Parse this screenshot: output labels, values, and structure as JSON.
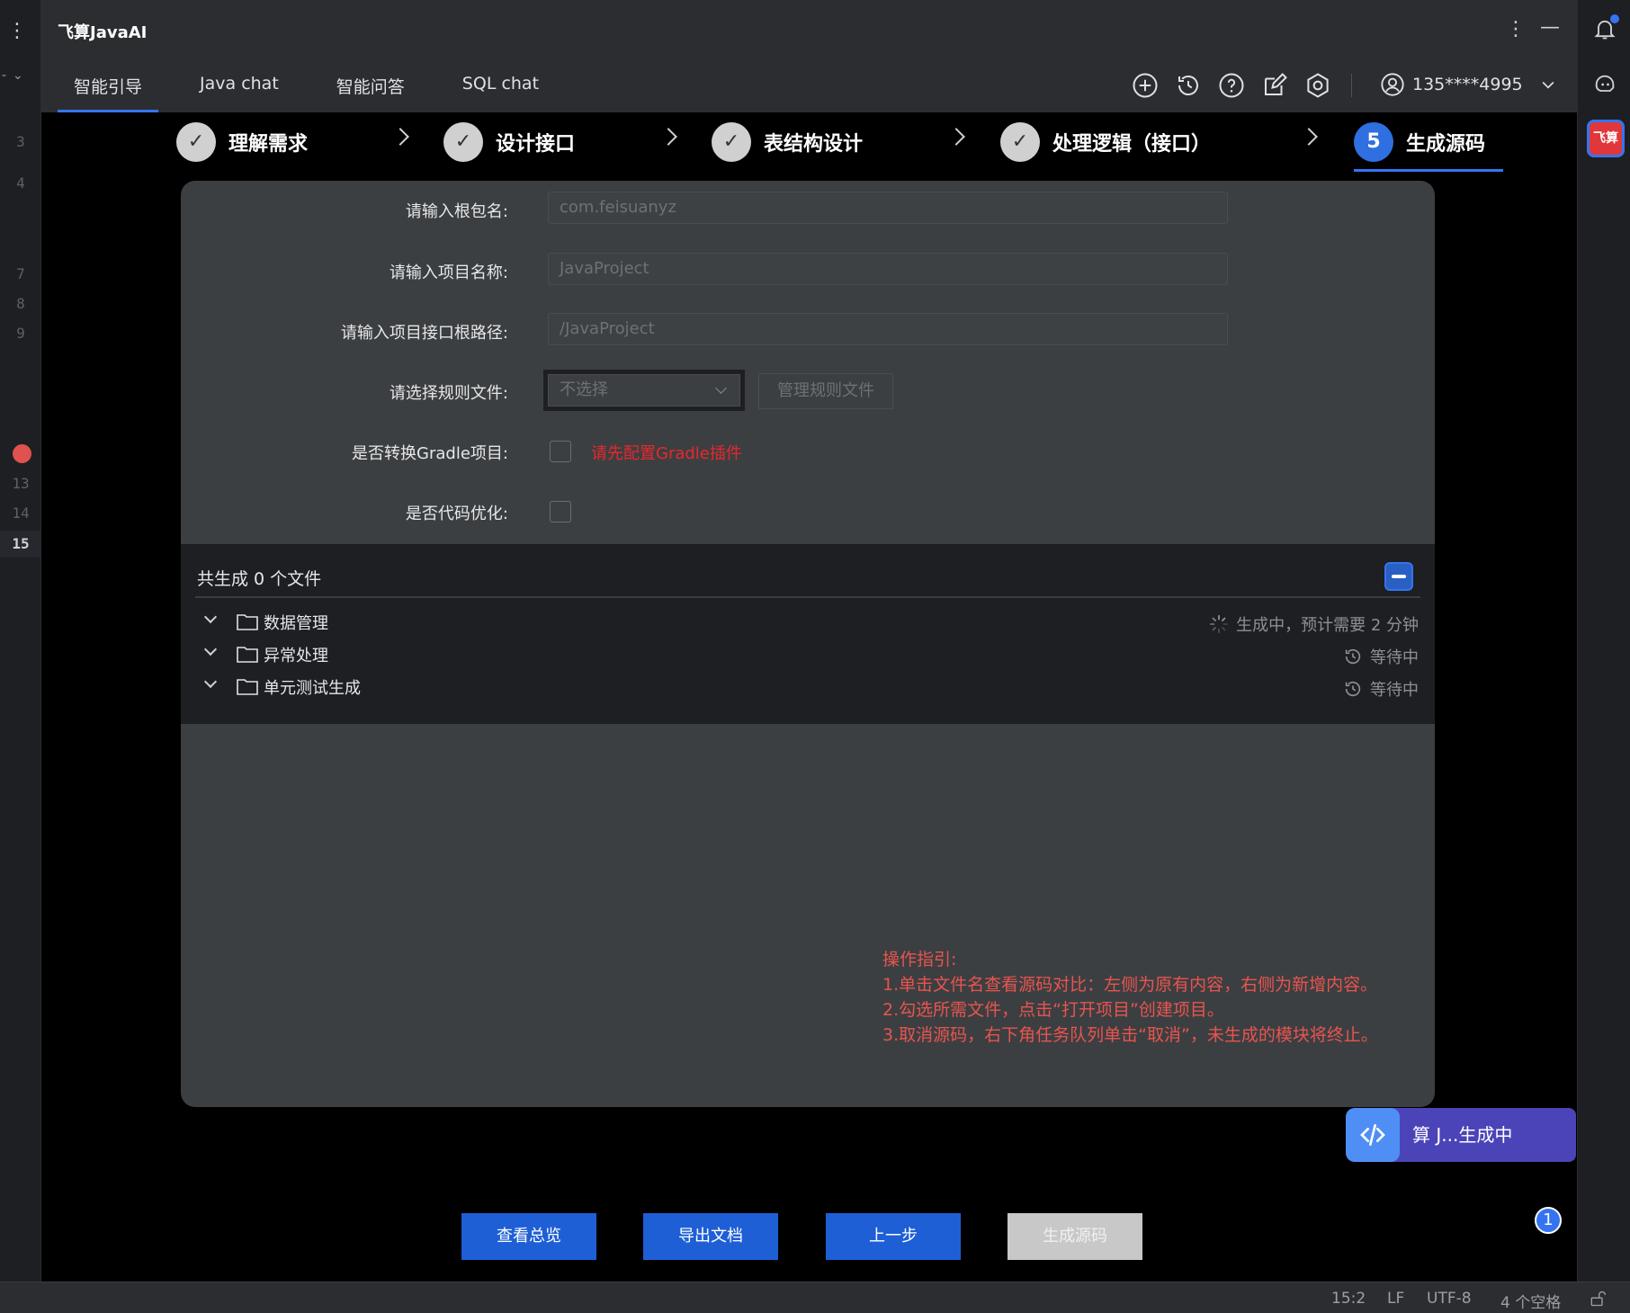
{
  "app": {
    "title": "飞算JavaAI"
  },
  "tabs": [
    {
      "label": "智能引导",
      "active": true
    },
    {
      "label": "Java chat",
      "active": false
    },
    {
      "label": "智能问答",
      "active": false
    },
    {
      "label": "SQL chat",
      "active": false
    }
  ],
  "user": {
    "phone": "135****4995"
  },
  "gutter": {
    "lines": [
      "3",
      "4",
      "7",
      "8",
      "9",
      "13",
      "14",
      "15"
    ],
    "active_line": "15"
  },
  "steps": [
    {
      "mark": "✓",
      "label": "理解需求"
    },
    {
      "mark": "✓",
      "label": "设计接口"
    },
    {
      "mark": "✓",
      "label": "表结构设计"
    },
    {
      "mark": "✓",
      "label": "处理逻辑（接口）"
    },
    {
      "mark": "5",
      "label": "生成源码",
      "current": true
    }
  ],
  "form": {
    "root_package": {
      "label": "请输入根包名:",
      "value": "com.feisuanyz"
    },
    "project_name": {
      "label": "请输入项目名称:",
      "value": "JavaProject"
    },
    "api_root": {
      "label": "请输入项目接口根路径:",
      "value": "/JavaProject"
    },
    "rule_file": {
      "label": "请选择规则文件:",
      "selected": "不选择",
      "manage_label": "管理规则文件"
    },
    "gradle": {
      "label": "是否转换Gradle项目:",
      "warning": "请先配置Gradle插件",
      "checked": false
    },
    "optimize": {
      "label": "是否代码优化:",
      "checked": false
    }
  },
  "files": {
    "header": "共生成 0 个文件",
    "items": [
      {
        "name": "数据管理",
        "status": "生成中，预计需要 2 分钟"
      },
      {
        "name": "异常处理",
        "status": "等待中"
      },
      {
        "name": "单元测试生成",
        "status": "等待中"
      }
    ]
  },
  "guide": {
    "title": "操作指引:",
    "lines": [
      "1.单击文件名查看源码对比：左侧为原有内容，右侧为新增内容。",
      "2.勾选所需文件，点击“打开项目”创建项目。",
      "3.取消源码，右下角任务队列单击“取消”，未生成的模块将终止。"
    ]
  },
  "buttons": {
    "overview": "查看总览",
    "export": "导出文档",
    "prev": "上一步",
    "generate": "生成源码"
  },
  "task": {
    "label": "算 J...生成中",
    "badge": "1"
  },
  "statusbar": {
    "position": "15:2",
    "line_ending": "LF",
    "encoding": "UTF-8",
    "indent": "4 个空格"
  },
  "colors": {
    "accent": "#3574f0",
    "warning": "#e8272d",
    "guide": "#e8544f",
    "panel": "#3c3f41"
  }
}
